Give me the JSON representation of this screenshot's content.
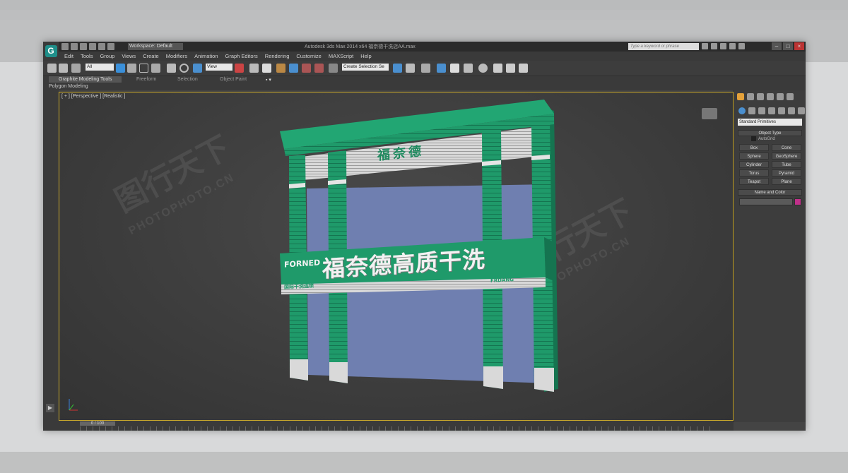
{
  "app": {
    "title": "Autodesk 3ds Max  2014 x64   福奈德干洗店AA.max",
    "workspace": "Workspace: Default",
    "search_placeholder": "Type a keyword or phrase"
  },
  "menu": [
    "Edit",
    "Tools",
    "Group",
    "Views",
    "Create",
    "Modifiers",
    "Animation",
    "Graph Editors",
    "Rendering",
    "Customize",
    "MAXScript",
    "Help"
  ],
  "toolbar": {
    "filter_value": "All",
    "refcoord_value": "View",
    "selection_set_value": "Create Selection Se"
  },
  "ribbon": {
    "tabs": [
      "Graphite Modeling Tools",
      "Freeform",
      "Selection",
      "Object Paint"
    ],
    "sub": "Polygon Modeling"
  },
  "viewport": {
    "label": "[ + ] [Perspective ] [Realistic ]"
  },
  "scene": {
    "top_sign": "福奈德",
    "main_sign": "福奈德高质干洗",
    "brand_en": "FORNED",
    "left_small": "国际干洗连锁",
    "right_small": "FRDANG",
    "colors": {
      "green": "#1f9a6a",
      "glass": "#6f7fb0",
      "sign_face": "#e4e4e4"
    }
  },
  "watermark": {
    "text": "图行天下",
    "sub": "PHOTOPHOTO.CN"
  },
  "command_panel": {
    "dropdown": "Standard Primitives",
    "object_type_head": "Object Type",
    "autogrid": "AutoGrid",
    "primitives": [
      "Box",
      "Cone",
      "Sphere",
      "GeoSphere",
      "Cylinder",
      "Tube",
      "Torus",
      "Pyramid",
      "Teapot",
      "Plane"
    ],
    "name_color_head": "Name and Color",
    "swatch_color": "#c0308a"
  },
  "timeline": {
    "frame": "0 / 100"
  }
}
